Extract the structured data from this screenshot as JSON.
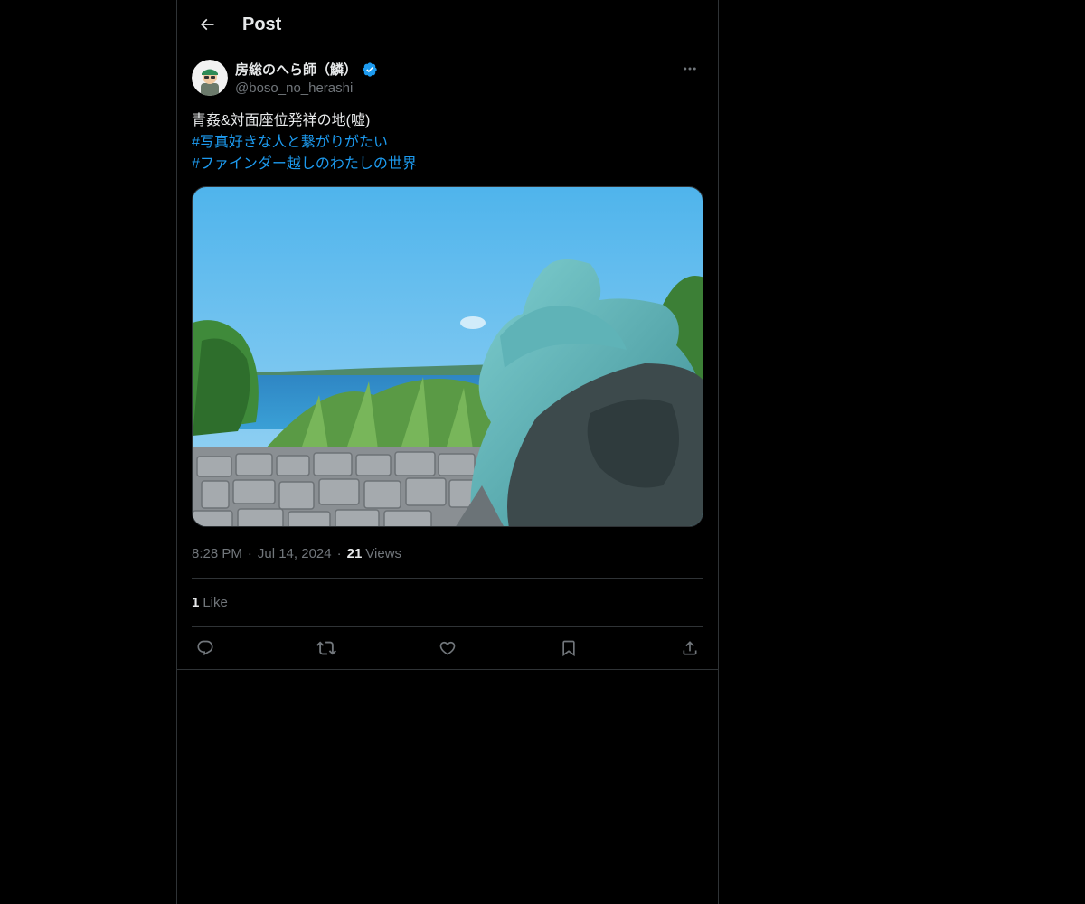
{
  "header": {
    "title": "Post"
  },
  "author": {
    "display_name": "房総のへら師（鱗）",
    "handle": "@boso_no_herashi",
    "verified": true
  },
  "post": {
    "text_line": "青姦&対面座位発祥の地(嘘)",
    "hashtags": [
      "#写真好きな人と繋がりがたい",
      "#ファインダー越しのわたしの世界"
    ],
    "time": "8:28 PM",
    "date": "Jul 14, 2024",
    "views_count": "21",
    "views_label": "Views",
    "likes_count": "1",
    "likes_label": "Like"
  },
  "colors": {
    "background": "#000000",
    "text": "#e7e9ea",
    "muted": "#71767b",
    "accent": "#1d9bf0",
    "border": "#2f3336"
  },
  "icons": [
    "back-arrow-icon",
    "verified-badge-icon",
    "more-icon",
    "reply-icon",
    "repost-icon",
    "like-icon",
    "bookmark-icon",
    "share-icon"
  ]
}
